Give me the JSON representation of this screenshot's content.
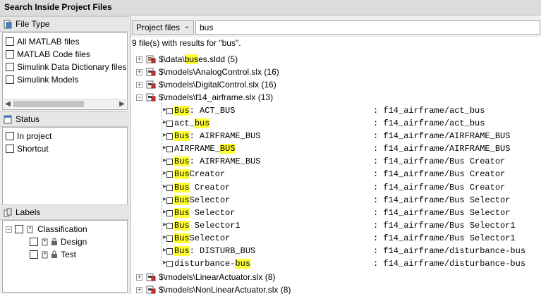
{
  "window": {
    "title": "Search Inside Project Files"
  },
  "filters": {
    "file_type": {
      "title": "File Type",
      "items": [
        "All MATLAB files",
        "MATLAB Code files",
        "Simulink Data Dictionary files",
        "Simulink Models"
      ]
    },
    "status": {
      "title": "Status",
      "items": [
        "In project",
        "Shortcut"
      ]
    },
    "labels": {
      "title": "Labels",
      "category": "Classification",
      "items": [
        "Design",
        "Test"
      ]
    }
  },
  "search": {
    "scope": "Project files",
    "query": "bus",
    "summary": "9 file(s) with results for \"bus\"."
  },
  "results": {
    "files": [
      {
        "pre": "$\\data\\",
        "hl": "bus",
        "post": "es.sldd (5)",
        "icon": "sldd-file-icon"
      },
      {
        "pre": "$\\models\\AnalogControl.slx (16)",
        "hl": "",
        "post": "",
        "icon": "slx-file-icon"
      },
      {
        "pre": "$\\models\\DigitalControl.slx (16)",
        "hl": "",
        "post": "",
        "icon": "slx-file-icon"
      },
      {
        "pre": "$\\models\\f14_airframe.slx (13)",
        "hl": "",
        "post": "",
        "icon": "slx-file-icon"
      },
      {
        "pre": "$\\models\\LinearActuator.slx (8)",
        "hl": "",
        "post": "",
        "icon": "slx-file-icon"
      },
      {
        "pre": "$\\models\\NonLinearActuator.slx (8)",
        "hl": "",
        "post": "",
        "icon": "slx-file-icon"
      }
    ],
    "matches": [
      {
        "pre": "",
        "hl": "Bus",
        "post": ": ACT_BUS",
        "loc": ": f14_airframe/act_bus"
      },
      {
        "pre": "act_",
        "hl": "bus",
        "post": "",
        "loc": ": f14_airframe/act_bus"
      },
      {
        "pre": "",
        "hl": "Bus",
        "post": ": AIRFRAME_BUS",
        "loc": ": f14_airframe/AIRFRAME_BUS"
      },
      {
        "pre": "AIRFRAME_",
        "hl": "BUS",
        "post": "",
        "loc": ": f14_airframe/AIRFRAME_BUS"
      },
      {
        "pre": "",
        "hl": "Bus",
        "post": ": AIRFRAME_BUS",
        "loc": ": f14_airframe/Bus Creator"
      },
      {
        "pre": "",
        "hl": "Bus",
        "post": "Creator",
        "loc": ": f14_airframe/Bus Creator"
      },
      {
        "pre": "",
        "hl": "Bus",
        "post": " Creator",
        "loc": ": f14_airframe/Bus Creator"
      },
      {
        "pre": "",
        "hl": "Bus",
        "post": "Selector",
        "loc": ": f14_airframe/Bus Selector"
      },
      {
        "pre": "",
        "hl": "Bus",
        "post": " Selector",
        "loc": ": f14_airframe/Bus Selector"
      },
      {
        "pre": "",
        "hl": "Bus",
        "post": " Selector1",
        "loc": ": f14_airframe/Bus Selector1"
      },
      {
        "pre": "",
        "hl": "Bus",
        "post": "Selector",
        "loc": ": f14_airframe/Bus Selector1"
      },
      {
        "pre": "",
        "hl": "Bus",
        "post": ": DISTURB_BUS",
        "loc": ": f14_airframe/disturbance-bus"
      },
      {
        "pre": "disturbance-",
        "hl": "bus",
        "post": "",
        "loc": ": f14_airframe/disturbance-bus"
      }
    ]
  },
  "colors": {
    "highlight": "#ffff33",
    "panel": "#f0f0f0",
    "border": "#a9a9a9"
  }
}
